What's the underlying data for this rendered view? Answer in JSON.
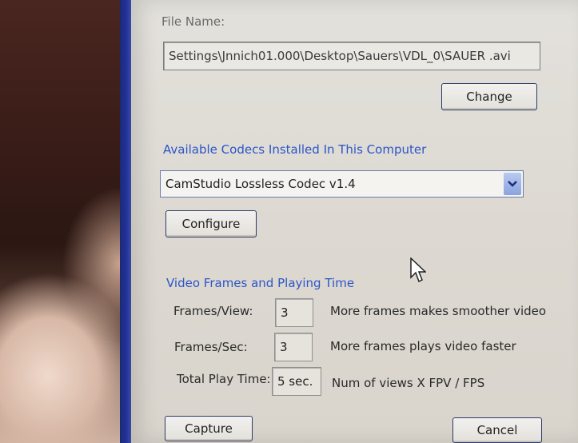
{
  "file_name": {
    "label": "File Name:",
    "value": "Settings\\Jnnich01.000\\Desktop\\Sauers\\VDL_0\\SAUER .avi",
    "change_button": "Change"
  },
  "codecs": {
    "group_label": "Available Codecs Installed In This Computer",
    "selected": "CamStudio Lossless Codec v1.4",
    "configure_button": "Configure"
  },
  "video": {
    "group_label": "Video Frames and Playing Time",
    "rows": [
      {
        "label": "Frames/View:",
        "value": "3",
        "hint": "More frames makes smoother video"
      },
      {
        "label": "Frames/Sec:",
        "value": "3",
        "hint": "More frames plays video faster"
      },
      {
        "label": "Total Play Time:",
        "value": "5 sec.",
        "hint": "Num of views  X  FPV  /  FPS"
      }
    ]
  },
  "actions": {
    "capture_button": "Capture",
    "cancel_button": "Cancel"
  },
  "icons": {
    "combo_dropdown": "chevron-down-icon",
    "mouse_pointer": "mouse-pointer-icon"
  },
  "colors": {
    "group_label": "#2c55c8",
    "dialog_bg": "#ddd9d2",
    "window_frame": "#23349a"
  }
}
